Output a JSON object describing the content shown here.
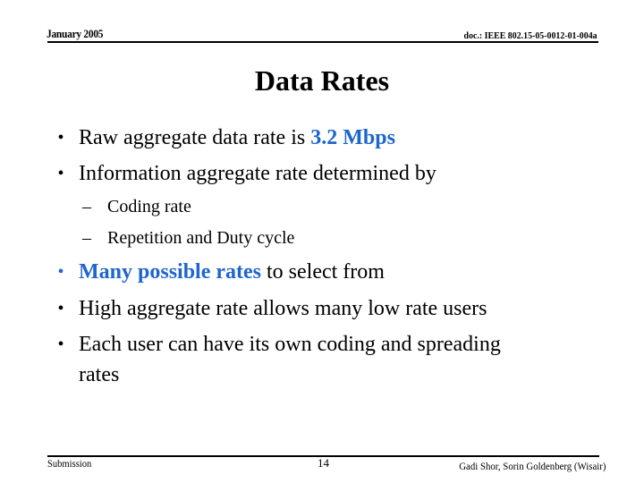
{
  "header": {
    "date": "January 2005",
    "doc_id": "doc.: IEEE 802.15-05-0012-01-004a"
  },
  "slide": {
    "title": "Data Rates",
    "colors": {
      "accent": "#1e66cc",
      "text": "#000000"
    },
    "bullets": [
      {
        "marker": "•",
        "text_before": "Raw aggregate data rate is ",
        "highlight": "3.2 Mbps",
        "text_after": ""
      },
      {
        "marker": "•",
        "text": "Information aggregate rate determined by",
        "sub_items": [
          {
            "marker": "–",
            "text": "Coding rate"
          },
          {
            "marker": "–",
            "text": "Repetition and Duty cycle"
          }
        ]
      },
      {
        "marker": "•",
        "highlight": "Many possible rates",
        "text_after": " to select from"
      },
      {
        "marker": "•",
        "text": "High aggregate rate allows many low rate users"
      },
      {
        "marker": "•",
        "text_line1": "Each user can have its own coding and spreading",
        "text_line2": "rates"
      }
    ]
  },
  "footer": {
    "label": "Submission",
    "page_number": "14",
    "authors": "Gadi Shor, Sorin Goldenberg (Wisair)"
  }
}
